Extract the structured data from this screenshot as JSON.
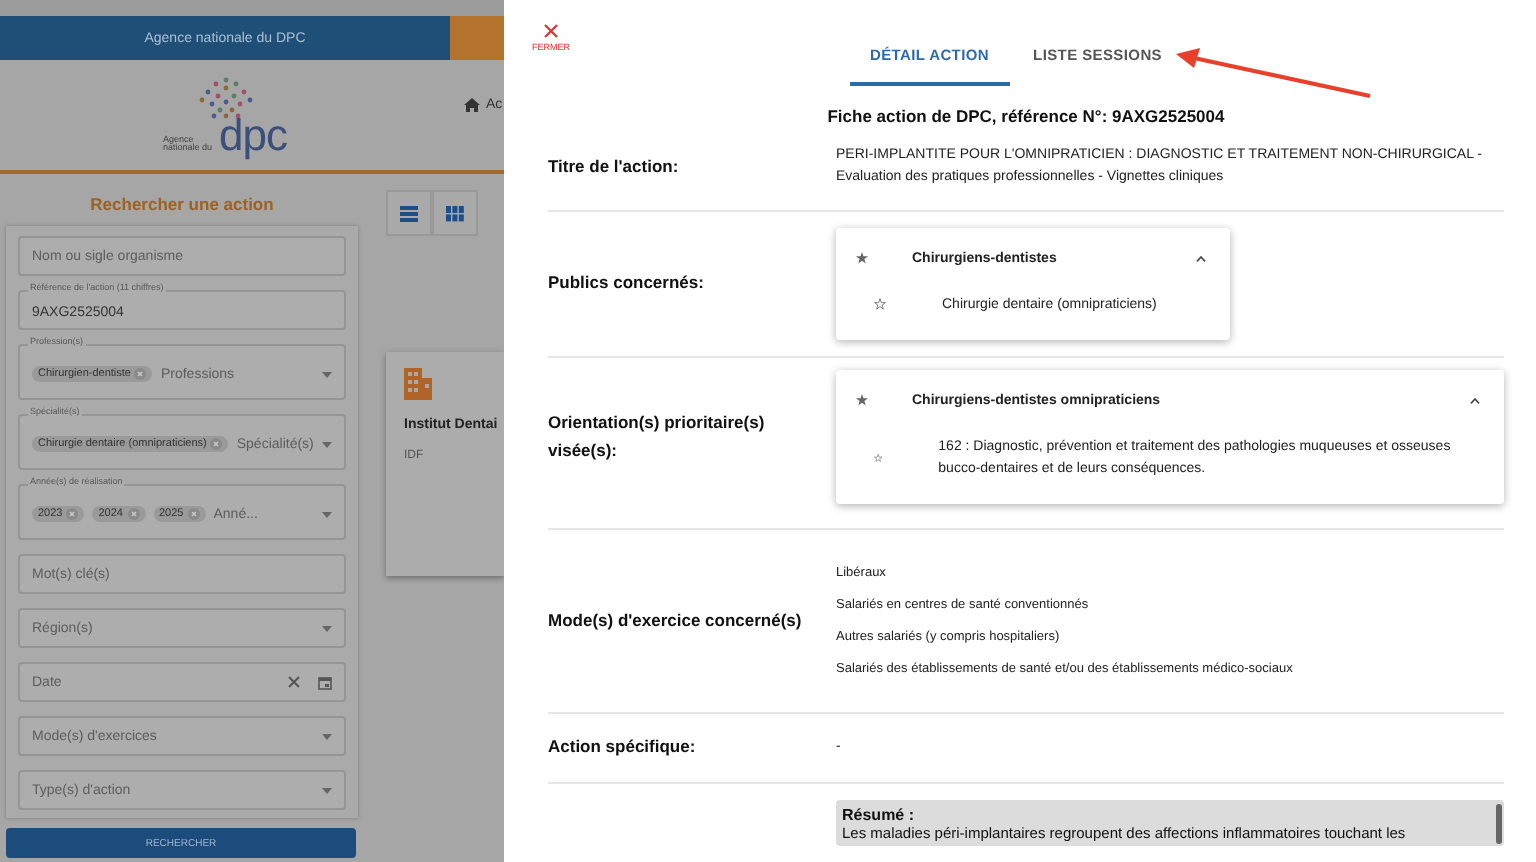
{
  "background_page": {
    "banner": "Agence nationale du DPC",
    "logo": {
      "wordmark": "dpc",
      "caption": "Agence nationale du"
    },
    "nav_link": "Ac",
    "search_panel": {
      "title": "Rechercher une action",
      "fields": [
        {
          "kind": "text",
          "placeholder": "Nom ou sigle organisme"
        },
        {
          "kind": "text",
          "label": "Référence de l'action (11 chiffres)",
          "value": "9AXG2525004"
        },
        {
          "kind": "chips",
          "label": "Profession(s)",
          "chips": [
            "Chirurgien-dentiste"
          ],
          "placeholder": "Professions"
        },
        {
          "kind": "chips",
          "label": "Spécialité(s)",
          "chips": [
            "Chirurgie dentaire (omnipraticiens)"
          ],
          "placeholder": "Spécialité(s)"
        },
        {
          "kind": "chips",
          "label": "Année(s) de réalisation",
          "chips": [
            "2023",
            "2024",
            "2025"
          ],
          "placeholder": "Anné..."
        },
        {
          "kind": "text",
          "placeholder": "Mot(s) clé(s)"
        },
        {
          "kind": "select",
          "placeholder": "Région(s)"
        },
        {
          "kind": "date",
          "placeholder": "Date"
        },
        {
          "kind": "select",
          "placeholder": "Mode(s) d'exercices"
        },
        {
          "kind": "select",
          "placeholder": "Type(s) d'action"
        }
      ],
      "button": "RECHERCHER"
    },
    "view_toggle": [
      {
        "kind": "list"
      },
      {
        "kind": "grid"
      }
    ],
    "result_card": {
      "name": "Institut Dentai",
      "region": "IDF"
    }
  },
  "drawer": {
    "close_label": "FERMER",
    "tabs": [
      {
        "label": "DÉTAIL ACTION",
        "selected": true
      },
      {
        "label": "LISTE SESSIONS",
        "selected": false
      }
    ],
    "heading": "Fiche action de DPC, référence N°: 9AXG2525004",
    "rows": [
      {
        "kind": "text",
        "label": "Titre de l'action:",
        "value": "PERI-IMPLANTITE POUR L'OMNIPRATICIEN : DIAGNOSTIC ET TRAITEMENT NON-CHIRURGICAL - Evaluation des pratiques professionnelles - Vignettes cliniques"
      },
      {
        "kind": "tree",
        "label": "Publics concernés:",
        "group": "Chirurgiens-dentistes",
        "expanded": true,
        "children": [
          "Chirurgie dentaire (omnipraticiens)"
        ]
      },
      {
        "kind": "tree",
        "label": "Orientation(s) prioritaire(s) visée(s):",
        "group": "Chirurgiens-dentistes omnipraticiens",
        "expanded": true,
        "children": [
          "162 : Diagnostic, prévention et traitement des pathologies muqueuses et osseuses bucco-dentaires et de leurs conséquences."
        ]
      },
      {
        "kind": "list",
        "label": "Mode(s) d'exercice concerné(s)",
        "items": [
          "Libéraux",
          "Salariés en centres de santé conventionnés",
          "Autres salariés (y compris hospitaliers)",
          "Salariés des établissements de santé et/ou des établissements médico-sociaux"
        ]
      },
      {
        "kind": "text",
        "label": "Action spécifique:",
        "value": "-"
      }
    ],
    "summary": {
      "title": "Résumé :",
      "text": "Les maladies péri-implantaires regroupent des affections inflammatoires touchant les"
    }
  }
}
